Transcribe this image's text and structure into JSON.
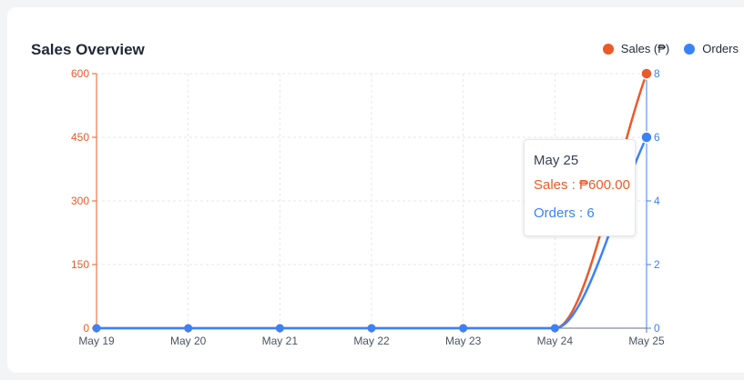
{
  "header": {
    "title": "Sales Overview"
  },
  "legend": [
    {
      "label": "Sales (₱)",
      "color": "#ea5a2a"
    },
    {
      "label": "Orders",
      "color": "#3b82f6"
    }
  ],
  "tooltip": {
    "date": "May 25",
    "sales_label": "Sales : ₱600.00",
    "orders_label": "Orders : 6"
  },
  "chart_data": {
    "type": "line",
    "categories": [
      "May 19",
      "May 20",
      "May 21",
      "May 22",
      "May 23",
      "May 24",
      "May 25"
    ],
    "series": [
      {
        "name": "Sales (₱)",
        "axis": "left",
        "values": [
          0,
          0,
          0,
          0,
          0,
          0,
          600
        ],
        "color": "#ea5a2a"
      },
      {
        "name": "Orders",
        "axis": "right",
        "values": [
          0,
          0,
          0,
          0,
          0,
          0,
          6
        ],
        "color": "#3b82f6"
      }
    ],
    "y_left": {
      "ticks": [
        "0",
        "150",
        "300",
        "450",
        "600"
      ],
      "ylim": [
        0,
        600
      ]
    },
    "y_right": {
      "ticks": [
        "0",
        "2",
        "4",
        "6",
        "8"
      ],
      "ylim": [
        0,
        8
      ]
    },
    "grid": true,
    "legend_position": "top-right"
  }
}
